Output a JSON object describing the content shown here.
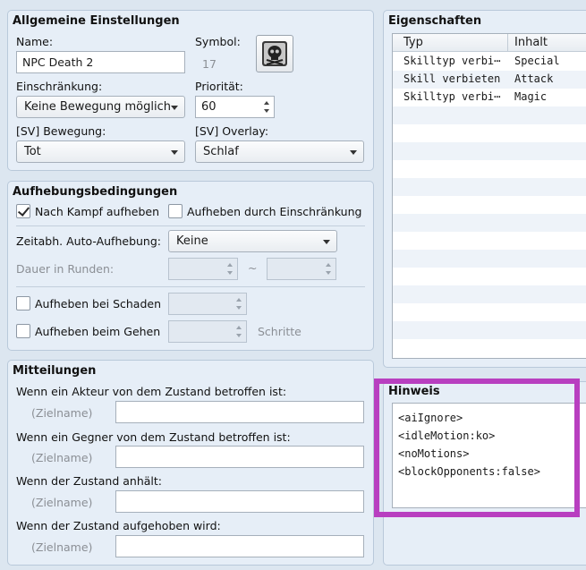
{
  "general": {
    "title": "Allgemeine Einstellungen",
    "name_label": "Name:",
    "name_value": "NPC Death 2",
    "symbol_label": "Symbol:",
    "symbol_index": "17",
    "restriction_label": "Einschränkung:",
    "restriction_value": "Keine Bewegung möglich",
    "priority_label": "Priorität:",
    "priority_value": "60",
    "sv_motion_label": "[SV] Bewegung:",
    "sv_motion_value": "Tot",
    "sv_overlay_label": "[SV] Overlay:",
    "sv_overlay_value": "Schlaf"
  },
  "removal": {
    "title": "Aufhebungsbedingungen",
    "after_battle_label": "Nach Kampf aufheben",
    "by_restriction_label": "Aufheben durch Einschränkung",
    "auto_removal_label": "Zeitabh. Auto-Aufhebung:",
    "auto_removal_value": "Keine",
    "duration_label": "Dauer in Runden:",
    "tilde": "~",
    "by_damage_label": "Aufheben bei Schaden",
    "by_walking_label": "Aufheben beim Gehen",
    "steps_label": "Schritte"
  },
  "messages": {
    "title": "Mitteilungen",
    "actor_label": "Wenn ein Akteur von dem Zustand betroffen ist:",
    "enemy_label": "Wenn ein Gegner von dem Zustand betroffen ist:",
    "persist_label": "Wenn der Zustand anhält:",
    "removed_label": "Wenn der Zustand aufgehoben wird:",
    "target_name": "(Zielname)"
  },
  "traits": {
    "title": "Eigenschaften",
    "col_type": "Typ",
    "col_content": "Inhalt",
    "rows": [
      {
        "type": "Skilltyp verbi⋯",
        "content": "Special"
      },
      {
        "type": "Skill verbieten",
        "content": "Attack"
      },
      {
        "type": "Skilltyp verbi⋯",
        "content": "Magic"
      }
    ]
  },
  "note": {
    "title": "Hinweis",
    "lines": [
      "<aiIgnore>",
      "<idleMotion:ko>",
      "<noMotions>",
      "<blockOpponents:false>"
    ]
  },
  "colors": {
    "highlight_border": "#b83fc0",
    "panel_bg": "#e6eef7"
  },
  "icons": {
    "symbol": "skull-crossbones-icon"
  }
}
